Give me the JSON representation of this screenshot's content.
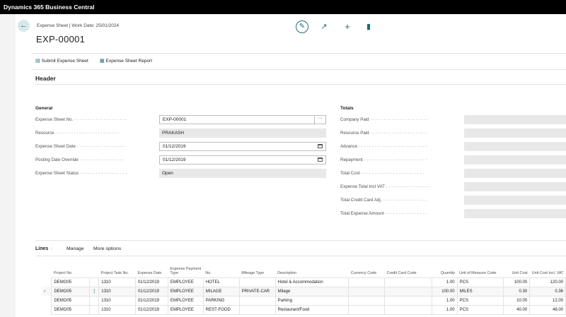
{
  "app": {
    "title": "Dynamics 365 Business Central"
  },
  "page": {
    "breadcrumb": "Expense Sheet | Work Date: 25/01/2024",
    "title": "EXP-00001"
  },
  "toolbar": {
    "edit_icon": "pencil-icon",
    "share_icon": "share-icon",
    "new_icon": "plus-icon",
    "delete_icon": "trash-icon"
  },
  "actions": {
    "submit_label": "Submit Expense Sheet",
    "report_label": "Expense Sheet Report"
  },
  "header": {
    "section_title": "Header",
    "general": {
      "title": "General",
      "fields": [
        {
          "label": "Expense Sheet No.",
          "value": "EXP-00001"
        },
        {
          "label": "Resource",
          "value": "PRAKASH"
        },
        {
          "label": "Expense Sheet Date",
          "value": "01/12/2019"
        },
        {
          "label": "Posting Date Override",
          "value": "01/12/2019"
        },
        {
          "label": "Expense Sheet Status",
          "value": "Open"
        }
      ]
    },
    "totals": {
      "title": "Totals",
      "fields": [
        {
          "label": "Company Paid",
          "value": ""
        },
        {
          "label": "Resource Paid",
          "value": ""
        },
        {
          "label": "Advance",
          "value": ""
        },
        {
          "label": "Repayment",
          "value": ""
        },
        {
          "label": "Total Cost",
          "value": ""
        },
        {
          "label": "Expense Total Incl VAT",
          "value": ""
        },
        {
          "label": "Total Credit Card Adj.",
          "value": ""
        },
        {
          "label": "Total Expense Amount",
          "value": ""
        }
      ]
    }
  },
  "lines": {
    "title": "Lines",
    "manage_label": "Manage",
    "more_options_label": "More options",
    "columns": [
      "Project No.",
      "Project Task No.",
      "Expense Date",
      "Expense Payment Type",
      "No.",
      "Mileage Type",
      "Description",
      "Currency Code",
      "Credit Card Code",
      "Quantity",
      "Unit of Measure Code",
      "Unit Cost",
      "Unit Cost Incl. VAT"
    ],
    "rows": [
      [
        "DEMO05",
        "1310",
        "01/12/2019",
        "EMPLOYEE",
        "HOTEL",
        "",
        "Hotel & Accommodation",
        "",
        "",
        "1.00",
        "PCS",
        "100.00",
        "120.00"
      ],
      [
        "DEMO05",
        "1310",
        "01/12/2019",
        "EMPLOYEE",
        "MILAGE",
        "PRIVATE-CAR",
        "Milage",
        "",
        "",
        "100.00",
        "MILES",
        "0.30",
        "0.36"
      ],
      [
        "DEMO05",
        "1310",
        "01/12/2019",
        "EMPLOYEE",
        "PARKING",
        "",
        "Parking",
        "",
        "",
        "1.00",
        "PCS",
        "10.00",
        "12.00"
      ],
      [
        "DEMO05",
        "1310",
        "01/12/2019",
        "EMPLOYEE",
        "REST-FOOD",
        "",
        "Restaurant/Food",
        "",
        "",
        "1.00",
        "PCS",
        "40.00",
        "48.00"
      ]
    ],
    "active_row_index": 1
  },
  "colors": {
    "accent": "#1f6b72",
    "topbar": "#000000"
  }
}
